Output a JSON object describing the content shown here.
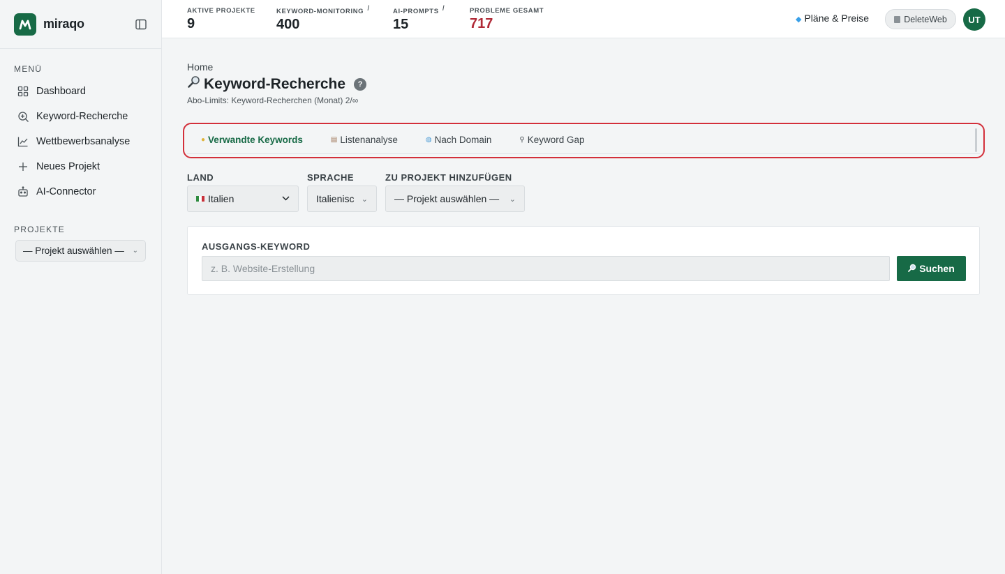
{
  "brand": {
    "name": "miraqo",
    "color": "#176a46"
  },
  "sidebar": {
    "menu_label": "MENÜ",
    "items": [
      {
        "label": "Dashboard",
        "icon": "grid-icon"
      },
      {
        "label": "Keyword-Recherche",
        "icon": "search-plus-icon"
      },
      {
        "label": "Wettbewerbsanalyse",
        "icon": "line-chart-icon"
      },
      {
        "label": "Neues Projekt",
        "icon": "plus-icon"
      },
      {
        "label": "AI-Connector",
        "icon": "robot-icon"
      }
    ],
    "projects_label": "PROJEKTE",
    "project_select": "— Projekt auswählen —"
  },
  "topbar": {
    "stats": [
      {
        "label": "AKTIVE PROJEKTE",
        "value": "9",
        "info": ""
      },
      {
        "label": "KEYWORD-MONITORING",
        "value": "400",
        "info": "i"
      },
      {
        "label": "AI-PROMPTS",
        "value": "15",
        "info": "i"
      },
      {
        "label": "PROBLEME GESAMT",
        "value": "717",
        "info": "",
        "color": "#b02a37"
      }
    ],
    "plans_label": "Pläne & Preise",
    "workspace_label": "DeleteWeb",
    "avatar_initials": "UT"
  },
  "page": {
    "breadcrumb": "Home",
    "title": "Keyword-Recherche",
    "help": "?",
    "limits": "Abo-Limits: Keyword-Recherchen (Monat) 2/∞"
  },
  "tabs": [
    {
      "label": "Verwandte Keywords",
      "icon": "lightbulb-icon",
      "active": true
    },
    {
      "label": "Listenanalyse",
      "icon": "clipboard-icon",
      "active": false
    },
    {
      "label": "Nach Domain",
      "icon": "globe-icon",
      "active": false
    },
    {
      "label": "Keyword Gap",
      "icon": "magnifier-icon",
      "active": false
    }
  ],
  "filters": {
    "land_label": "LAND",
    "land_value": "Italien",
    "sprache_label": "SPRACHE",
    "sprache_value": "Italienisc",
    "projekt_label": "ZU PROJEKT HINZUFÜGEN",
    "projekt_value": "— Projekt auswählen —"
  },
  "search": {
    "label": "AUSGANGS-KEYWORD",
    "placeholder": "z. B. Website-Erstellung",
    "value": "",
    "button_label": "Suchen"
  },
  "colors": {
    "accent": "#176a46",
    "danger": "#b02a37",
    "highlight_border": "#d32f3a"
  }
}
